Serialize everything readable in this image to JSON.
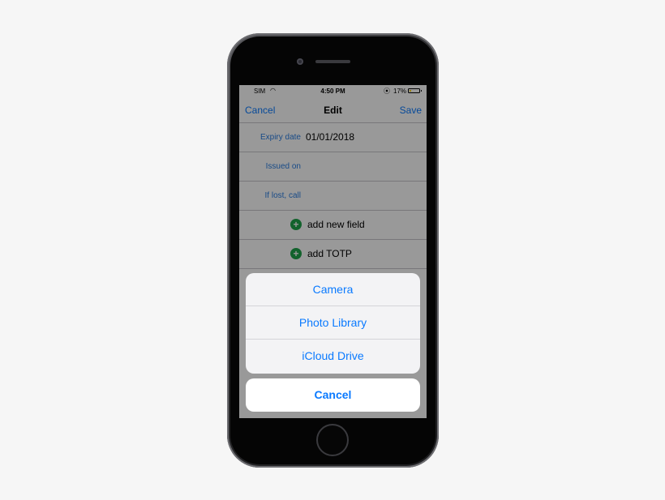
{
  "status_bar": {
    "carrier": "SIM",
    "wifi_icon": "wifi-icon",
    "time": "4:50 PM",
    "lock_icon": "orientation-lock-icon",
    "battery_percent": "17%",
    "battery_level": 0.17,
    "battery_color": "#ffd60a"
  },
  "nav": {
    "cancel_label": "Cancel",
    "title": "Edit",
    "save_label": "Save"
  },
  "fields": [
    {
      "label": "Expiry date",
      "value": "01/01/2018"
    },
    {
      "label": "Issued on",
      "value": ""
    },
    {
      "label": "If lost, call",
      "value": ""
    }
  ],
  "actions": [
    {
      "icon": "add-circle-icon",
      "symbol": "+",
      "label": "add new field"
    },
    {
      "icon": "add-circle-icon",
      "symbol": "+",
      "label": "add TOTP"
    }
  ],
  "action_sheet": {
    "items": [
      "Camera",
      "Photo Library",
      "iCloud Drive"
    ],
    "cancel_label": "Cancel"
  },
  "colors": {
    "accent": "#0a7aff",
    "field_label": "#2a7de1",
    "add_icon": "#1fa34a"
  }
}
